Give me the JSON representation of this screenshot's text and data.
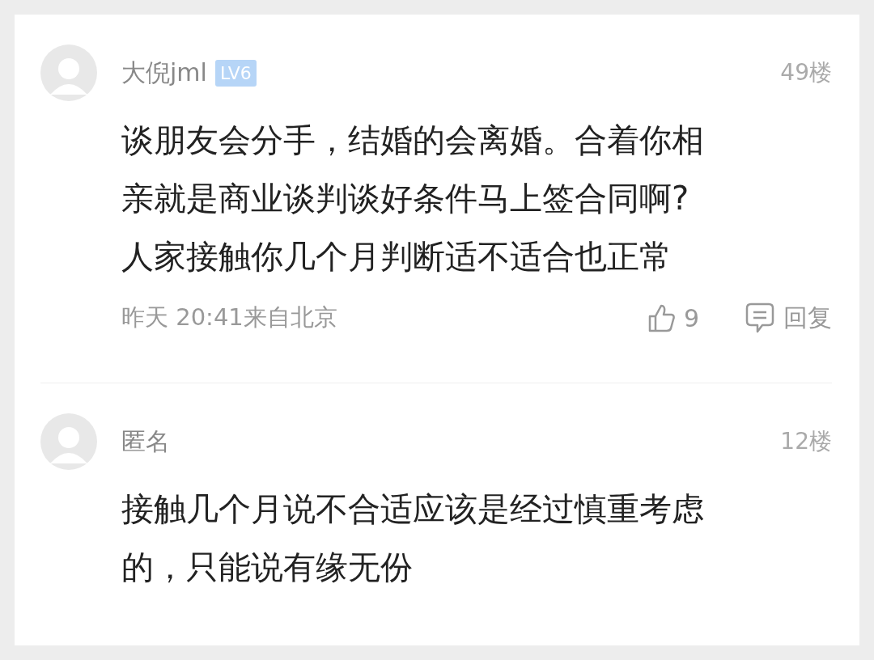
{
  "comments": [
    {
      "user": "大倪jml",
      "badge": "LV6",
      "floor": "49楼",
      "lines": [
        "谈朋友会分手，结婚的会离婚。合着你相",
        "亲就是商业谈判谈好条件马上签合同啊?",
        "人家接触你几个月判断适不适合也正常"
      ],
      "time": "昨天 20:41来自北京",
      "likes": "9",
      "reply": "回复"
    },
    {
      "user": "匿名",
      "floor": "12楼",
      "lines": [
        "接触几个月说不合适应该是经过慎重考虑",
        "的，只能说有缘无份"
      ]
    }
  ]
}
